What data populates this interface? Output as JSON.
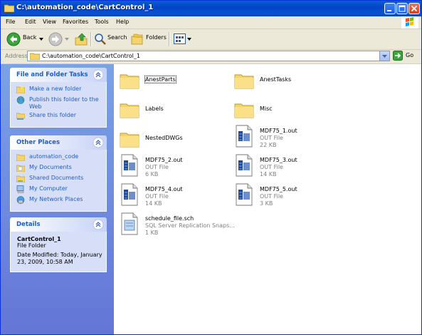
{
  "window": {
    "title": "C:\\automation_code\\CartControl_1"
  },
  "menu": [
    "File",
    "Edit",
    "View",
    "Favorites",
    "Tools",
    "Help"
  ],
  "toolbar": {
    "back": "Back",
    "search": "Search",
    "folders": "Folders"
  },
  "address": {
    "label": "Address",
    "path": "C:\\automation_code\\CartControl_1",
    "go": "Go"
  },
  "tasks_panel": {
    "title": "File and Folder Tasks",
    "items": [
      "Make a new folder",
      "Publish this folder to the Web",
      "Share this folder"
    ]
  },
  "places_panel": {
    "title": "Other Places",
    "items": [
      "automation_code",
      "My Documents",
      "Shared Documents",
      "My Computer",
      "My Network Places"
    ]
  },
  "details_panel": {
    "title": "Details",
    "name": "CartControl_1",
    "type": "File Folder",
    "modified_1": "Date Modified: Today, January",
    "modified_2": "23, 2009, 10:58 AM"
  },
  "files": [
    {
      "name": "AnestParts",
      "kind": "folder"
    },
    {
      "name": "AnestTasks",
      "kind": "folder"
    },
    {
      "name": "Labels",
      "kind": "folder"
    },
    {
      "name": "Misc",
      "kind": "folder"
    },
    {
      "name": "NestedDWGs",
      "kind": "folder"
    },
    {
      "name": "MDF75_1.out",
      "kind": "out",
      "type": "OUT File",
      "size": "22 KB"
    },
    {
      "name": "MDF75_2.out",
      "kind": "out",
      "type": "OUT File",
      "size": "6 KB"
    },
    {
      "name": "MDF75_3.out",
      "kind": "out",
      "type": "OUT File",
      "size": "14 KB"
    },
    {
      "name": "MDF75_4.out",
      "kind": "out",
      "type": "OUT File",
      "size": "14 KB"
    },
    {
      "name": "MDF75_5.out",
      "kind": "out",
      "type": "OUT File",
      "size": "3 KB"
    },
    {
      "name": "schedule_file.sch",
      "kind": "sch",
      "type": "SQL Server Replication Snaps...",
      "size": "1 KB"
    }
  ]
}
